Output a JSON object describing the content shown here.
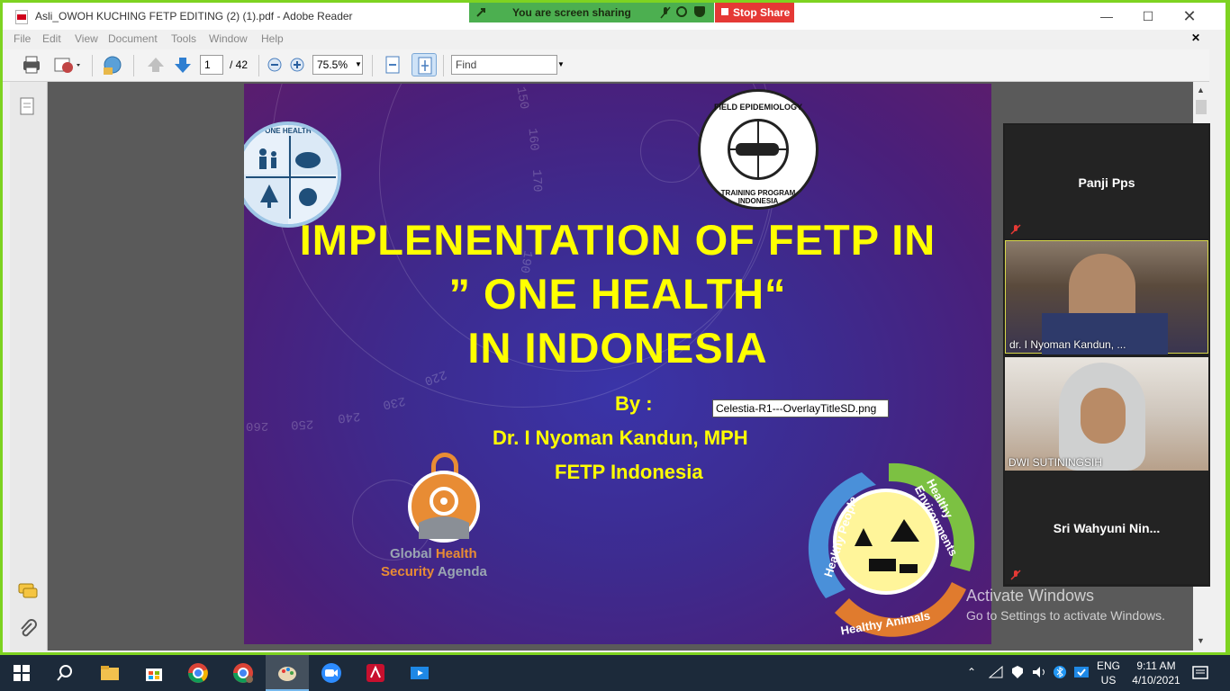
{
  "window": {
    "title": "Asli_OWOH KUCHING FETP EDITING (2) (1).pdf - Adobe Reader",
    "share_status": "You are screen sharing",
    "stop_share": "Stop Share"
  },
  "menu": [
    "File",
    "Edit",
    "View",
    "Document",
    "Tools",
    "Window",
    "Help"
  ],
  "toolbar": {
    "page_current": "1",
    "page_total": "/ 42",
    "zoom": "75.5%",
    "find_placeholder": "Find"
  },
  "slide": {
    "line1": "IMPLENENTATION OF FETP IN",
    "line2": "” ONE HEALTH“",
    "line3": "IN INDONESIA",
    "by": "By  :",
    "author": "Dr. I Nyoman Kandun, MPH",
    "org": "FETP Indonesia",
    "one_health_logo_text": "ONE HEALTH",
    "fetp_logo_top": "FIELD EPIDEMIOLOGY",
    "fetp_logo_bottom": "TRAINING PROGRAM INDONESIA",
    "ghsa_line1_a": "Global ",
    "ghsa_line1_b": "Health",
    "ghsa_line2_a": "Security ",
    "ghsa_line2_b": "Agenda",
    "cycle_people": "Healthy People",
    "cycle_env": "Healthy Environments",
    "cycle_animals": "Healthy Animals",
    "dial_marks": [
      "150",
      "160",
      "170",
      "190",
      "220",
      "230",
      "240",
      "250",
      "260"
    ]
  },
  "tooltip": "Celestia-R1---OverlayTitleSD.png",
  "participants": [
    {
      "name": "Panji Pps",
      "video": false,
      "muted": true
    },
    {
      "name": "dr. I Nyoman Kandun, ...",
      "video": true,
      "muted": false
    },
    {
      "name": "DWI SUTININGSIH",
      "video": true,
      "muted": false
    },
    {
      "name": "Sri  Wahyuni  Nin...",
      "video": false,
      "muted": true
    }
  ],
  "watermark": {
    "line1": "Activate Windows",
    "line2": "Go to Settings to activate Windows."
  },
  "taskbar": {
    "lang1": "ENG",
    "lang2": "US",
    "time": "9:11 AM",
    "date": "4/10/2021"
  },
  "colors": {
    "share_border": "#7ed321",
    "slide_title": "#ffff00",
    "ghsa_orange": "#e88c34",
    "taskbar": "#1c2a3a"
  }
}
